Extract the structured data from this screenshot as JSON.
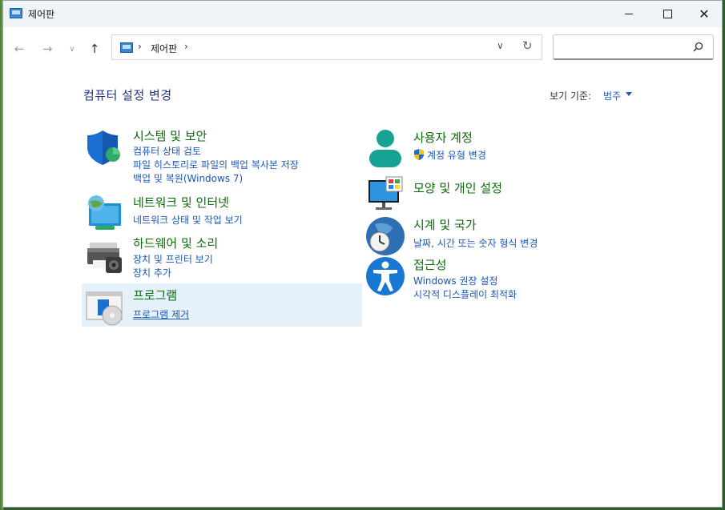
{
  "window": {
    "title": "제어판"
  },
  "address": {
    "crumb": "제어판",
    "sep": "›"
  },
  "search": {
    "placeholder": ""
  },
  "page_title": "컴퓨터 설정 변경",
  "view_by": {
    "label": "보기 기준:",
    "value": "범주"
  },
  "categories_left": [
    {
      "title": "시스템 및 보안",
      "icon": "shield-icon",
      "links": [
        "컴퓨터 상태 검토",
        "파일 히스토리로 파일의 백업 복사본 저장",
        "백업 및 복원(Windows 7)"
      ]
    },
    {
      "title": "네트워크 및 인터넷",
      "icon": "network-icon",
      "links": [
        "네트워크 상태 및 작업 보기"
      ]
    },
    {
      "title": "하드웨어 및 소리",
      "icon": "printer-icon",
      "links": [
        "장치 및 프린터 보기",
        "장치 추가"
      ]
    },
    {
      "title": "프로그램",
      "icon": "programs-icon",
      "links": [
        "프로그램 제거"
      ]
    }
  ],
  "categories_right": [
    {
      "title": "사용자 계정",
      "icon": "user-icon",
      "links": [
        "계정 유형 변경"
      ]
    },
    {
      "title": "모양 및 개인 설정",
      "icon": "monitor-icon",
      "links": []
    },
    {
      "title": "시계 및 국가",
      "icon": "clock-globe-icon",
      "links": [
        "날짜, 시간 또는 숫자 형식 변경"
      ]
    },
    {
      "title": "접근성",
      "icon": "accessibility-icon",
      "links": [
        "Windows 권장 설정",
        "시각적 디스플레이 최적화"
      ]
    }
  ],
  "colors": {
    "accent": "#1a57b7",
    "category_title": "#0b6b0b",
    "selected": "#e5f1fb"
  }
}
